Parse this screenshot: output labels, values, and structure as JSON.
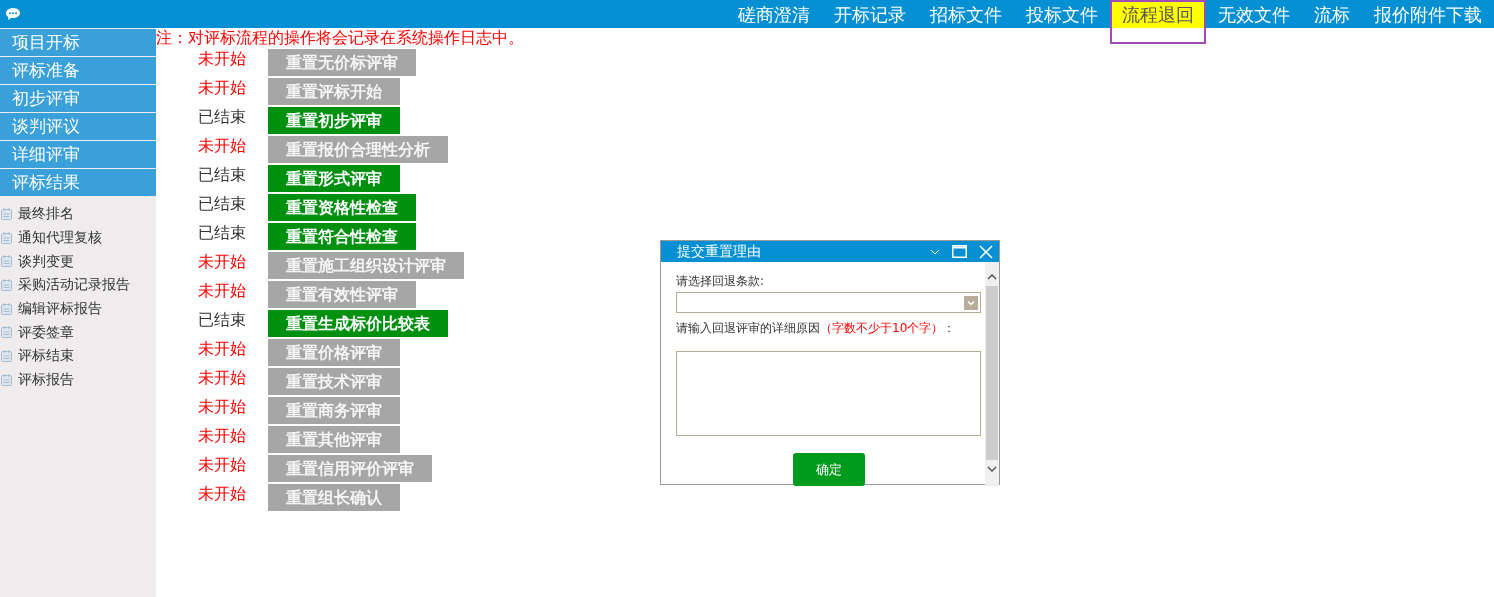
{
  "top_nav": [
    {
      "label": "磋商澄清",
      "selected": false
    },
    {
      "label": "开标记录",
      "selected": false
    },
    {
      "label": "招标文件",
      "selected": false
    },
    {
      "label": "投标文件",
      "selected": false
    },
    {
      "label": "流程退回",
      "selected": true
    },
    {
      "label": "无效文件",
      "selected": false
    },
    {
      "label": "流标",
      "selected": false
    },
    {
      "label": "报价附件下载",
      "selected": false
    }
  ],
  "sidebar": {
    "sections": [
      {
        "label": "项目开标"
      },
      {
        "label": "评标准备"
      },
      {
        "label": "初步评审"
      },
      {
        "label": "谈判评议"
      },
      {
        "label": "详细评审"
      },
      {
        "label": "评标结果"
      }
    ],
    "items": [
      {
        "label": "最终排名"
      },
      {
        "label": "通知代理复核"
      },
      {
        "label": "谈判变更"
      },
      {
        "label": "采购活动记录报告"
      },
      {
        "label": "编辑评标报告"
      },
      {
        "label": "评委签章"
      },
      {
        "label": "评标结束"
      },
      {
        "label": "评标报告"
      }
    ]
  },
  "notice": "注：对评标流程的操作将会记录在系统操作日志中。",
  "steps": [
    {
      "status": "未开始",
      "finished": false,
      "button": "重置无价标评审"
    },
    {
      "status": "未开始",
      "finished": false,
      "button": "重置评标开始"
    },
    {
      "status": "已结束",
      "finished": true,
      "button": "重置初步评审"
    },
    {
      "status": "未开始",
      "finished": false,
      "button": "重置报价合理性分析"
    },
    {
      "status": "已结束",
      "finished": true,
      "button": "重置形式评审"
    },
    {
      "status": "已结束",
      "finished": true,
      "button": "重置资格性检查"
    },
    {
      "status": "已结束",
      "finished": true,
      "button": "重置符合性检查"
    },
    {
      "status": "未开始",
      "finished": false,
      "button": "重置施工组织设计评审"
    },
    {
      "status": "未开始",
      "finished": false,
      "button": "重置有效性评审"
    },
    {
      "status": "已结束",
      "finished": true,
      "button": "重置生成标价比较表"
    },
    {
      "status": "未开始",
      "finished": false,
      "button": "重置价格评审"
    },
    {
      "status": "未开始",
      "finished": false,
      "button": "重置技术评审"
    },
    {
      "status": "未开始",
      "finished": false,
      "button": "重置商务评审"
    },
    {
      "status": "未开始",
      "finished": false,
      "button": "重置其他评审"
    },
    {
      "status": "未开始",
      "finished": false,
      "button": "重置信用评价评审"
    },
    {
      "status": "未开始",
      "finished": false,
      "button": "重置组长确认"
    }
  ],
  "dialog": {
    "title": "提交重置理由",
    "clause_label": "请选择回退条款:",
    "reason_label": "请输入回退评审的详细原因",
    "reason_hint": "（字数不少于10个字）",
    "reason_colon": "：",
    "confirm": "确定"
  }
}
